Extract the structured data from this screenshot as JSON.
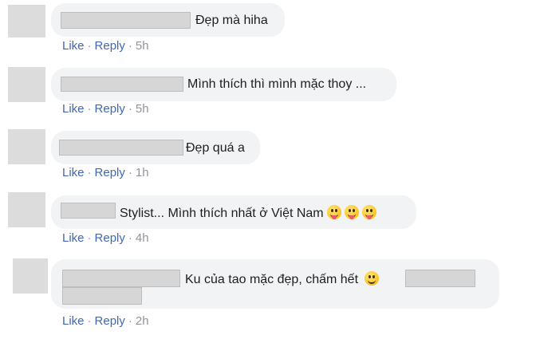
{
  "comments": [
    {
      "text": "Đẹp mà hiha",
      "like": "Like",
      "reply": "Reply",
      "time": "5h"
    },
    {
      "text": "Mình thích thì mình mặc thoy ...",
      "like": "Like",
      "reply": "Reply",
      "time": "5h"
    },
    {
      "text": "Đẹp quá a",
      "like": "Like",
      "reply": "Reply",
      "time": "1h"
    },
    {
      "text": "Stylist... Mình thích nhất ở Việt Nam",
      "like": "Like",
      "reply": "Reply",
      "time": "4h",
      "emojis": [
        "stuck-out-tongue-icon",
        "stuck-out-tongue-icon",
        "stuck-out-tongue-icon"
      ]
    },
    {
      "text": "Ku của tao mặc đẹp, chấm hết",
      "like": "Like",
      "reply": "Reply",
      "time": "2h",
      "emojis": [
        "smile-icon"
      ]
    }
  ],
  "separator": "·",
  "colors": {
    "bubble": "#f2f3f5",
    "link": "#4267b2",
    "meta": "#90949c",
    "text": "#1c1e21",
    "redacted": "#d6d6d6"
  }
}
